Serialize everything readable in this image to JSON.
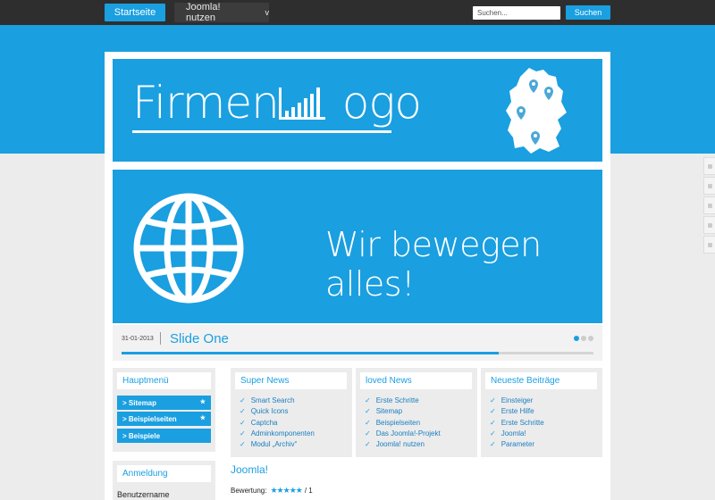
{
  "topbar": {
    "home_label": "Startseite",
    "menu_label": "Joomla! nutzen",
    "menu_chevron": "v",
    "search_placeholder": "Suchen...",
    "search_button": "Suchen"
  },
  "colors": {
    "accent": "#1a9fe0",
    "topbar": "#2e2e2e",
    "background": "#ececec"
  },
  "header": {
    "logo_text_1": "Firmen ",
    "logo_text_2": "ogo",
    "map_icon": "germany-map-with-pins"
  },
  "slide": {
    "slogan": "Wir bewegen alles!",
    "icon": "globe-icon",
    "date": "31-01-2013",
    "title": "Slide One",
    "progress": 0.8,
    "dot_count": 3,
    "active_dot": 0
  },
  "sidebar": {
    "menu_title": "Hauptmenü",
    "items": [
      {
        "label": "> Sitemap",
        "star": "★"
      },
      {
        "label": "> Beispielseiten",
        "star": "★"
      },
      {
        "label": "> Beispiele",
        "star": ""
      }
    ],
    "login_title": "Anmeldung",
    "username_label": "Benutzername"
  },
  "news": [
    {
      "title": "Super News",
      "items": [
        "Smart Search",
        "Quick Icons",
        "Captcha",
        "Adminkomponenten",
        "Modul „Archiv“"
      ]
    },
    {
      "title": "loved News",
      "items": [
        "Erste Schritte",
        "Sitemap",
        "Beispielseiten",
        "Das Joomla!-Projekt",
        "Joomla! nutzen"
      ]
    },
    {
      "title": "Neueste Beiträge",
      "items": [
        "Einsteiger",
        "Erste Hilfe",
        "Erste Schritte",
        "Joomla!",
        "Parameter"
      ]
    }
  ],
  "article": {
    "title": "Joomla!",
    "rating_label": "Bewertung:",
    "rating_value": 5,
    "rating_max": 5,
    "rating_suffix": "/ 1"
  },
  "share_tabs": [
    "facebook-icon",
    "twitter-icon",
    "google-icon",
    "linkedin-icon",
    "email-icon"
  ]
}
